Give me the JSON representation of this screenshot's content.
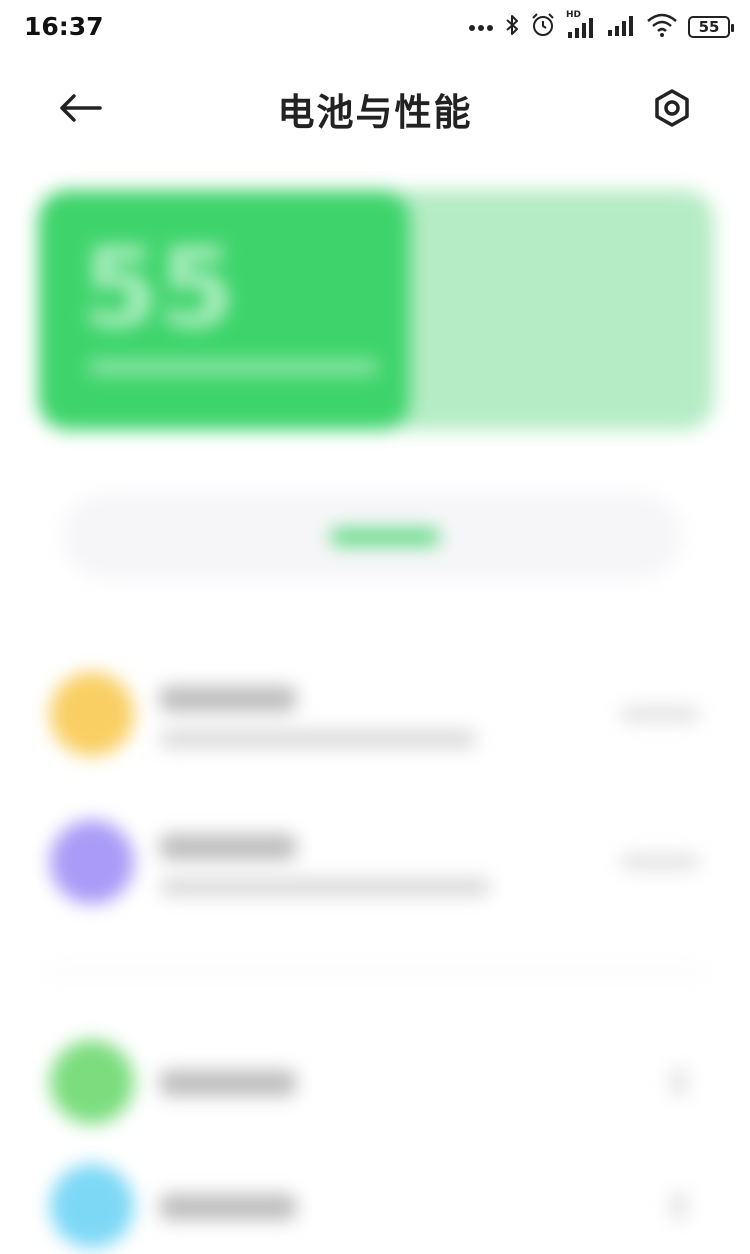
{
  "status_bar": {
    "time": "16:37",
    "icons": [
      "more-dots-icon",
      "bluetooth-icon",
      "alarm-icon",
      "hd-signal-icon",
      "signal-icon",
      "wifi-icon",
      "battery-icon"
    ],
    "hd_label": "HD",
    "battery_percent": "55"
  },
  "header": {
    "title": "电池与性能",
    "back_icon": "back-arrow-icon",
    "settings_icon": "settings-hexagon-icon"
  },
  "battery_card": {
    "level_text": "55",
    "level_fraction": 0.55,
    "fill_color": "#3ed46b",
    "track_color": "#b5ecc5"
  },
  "list_items": [
    {
      "icon_color": "#f9cf63"
    },
    {
      "icon_color": "#a99bf7"
    },
    {
      "icon_color": "#7bdd7e"
    },
    {
      "icon_color": "#7dd8f6"
    }
  ]
}
